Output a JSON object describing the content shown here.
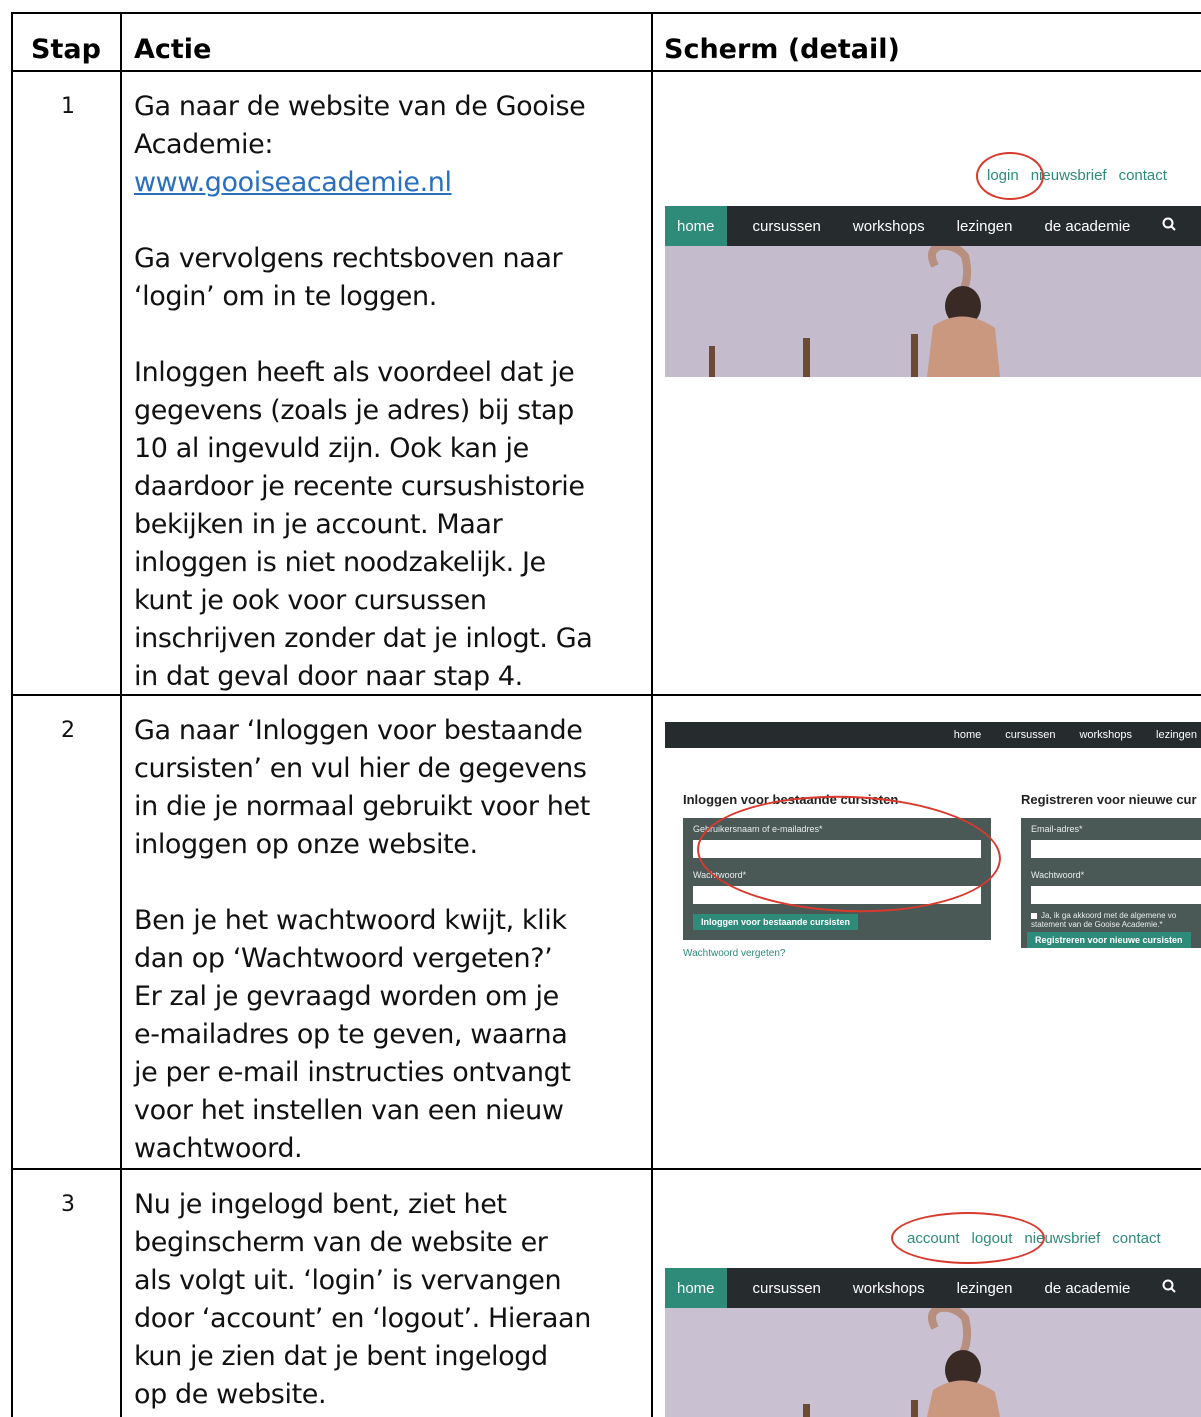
{
  "table": {
    "headers": [
      "Stap",
      "Actie",
      "Scherm (detail)"
    ]
  },
  "rows": [
    {
      "step": "1",
      "paragraphs": [
        [
          "Ga naar de website van de Gooise",
          "Academie:"
        ],
        [
          "Ga vervolgens rechtsboven naar",
          "‘login’ om in te loggen."
        ],
        [
          "Inloggen heeft als voordeel dat je",
          "gegevens (zoals je adres) bij stap",
          "10 al ingevuld zijn. Ook kan je",
          "daardoor je recente cursushistorie",
          "bekijken in je account. Maar",
          "inloggen is niet noodzakelijk. Je",
          "kunt je ook voor cursussen",
          "inschrijven zonder dat je inlogt. Ga",
          "in dat geval door naar stap 4."
        ]
      ],
      "link": "www.gooiseacademie.nl"
    },
    {
      "step": "2",
      "paragraphs": [
        [
          "Ga naar ‘Inloggen voor bestaande",
          "cursisten’ en vul hier de gegevens",
          "in die je normaal gebruikt voor het",
          "inloggen op onze website."
        ],
        [
          "Ben je het wachtwoord kwijt, klik",
          "dan op ‘Wachtwoord vergeten?’",
          "Er zal je gevraagd worden om je",
          "e-mailadres op te geven, waarna",
          "je per e-mail instructies ontvangt",
          "voor het instellen van een nieuw",
          "wachtwoord."
        ]
      ]
    },
    {
      "step": "3",
      "paragraphs": [
        [
          "Nu je ingelogd bent, ziet het",
          "beginscherm van de website er",
          "als volgt uit. ‘login’ is vervangen",
          "door ‘account’ en ‘logout’. Hieraan",
          "kun je zien dat je bent ingelogd",
          "op de website."
        ]
      ]
    }
  ],
  "shot1": {
    "top_links": [
      "login",
      "nieuwsbrief",
      "contact"
    ],
    "nav": [
      "home",
      "cursussen",
      "workshops",
      "lezingen",
      "de academie"
    ],
    "search_icon": "search-icon"
  },
  "shot2": {
    "nav": [
      "home",
      "cursussen",
      "workshops",
      "lezingen"
    ],
    "login_title": "Inloggen voor bestaande cursisten",
    "login_user_label": "Gebruikersnaam of e-mailadres*",
    "login_pass_label": "Wachtwoord*",
    "login_button": "Inloggen voor bestaande cursisten",
    "forgot_link": "Wachtwoord vergeten?",
    "register_title": "Registreren voor nieuwe cur",
    "register_email_label": "Email-adres*",
    "register_pass_label": "Wachtwoord*",
    "register_check_line1": "Ja, ik ga akkoord met de algemene vo",
    "register_check_line2": "statement van de Gooise Academie.*",
    "register_button": "Registreren voor nieuwe cursisten"
  },
  "shot3": {
    "top_links": [
      "account",
      "logout",
      "nieuwsbrief",
      "contact"
    ],
    "nav": [
      "home",
      "cursussen",
      "workshops",
      "lezingen",
      "de academie"
    ],
    "search_icon": "search-icon"
  },
  "colors": {
    "accent": "#2e8b7a",
    "navbar": "#262b2e",
    "highlight": "#d83a2e"
  }
}
